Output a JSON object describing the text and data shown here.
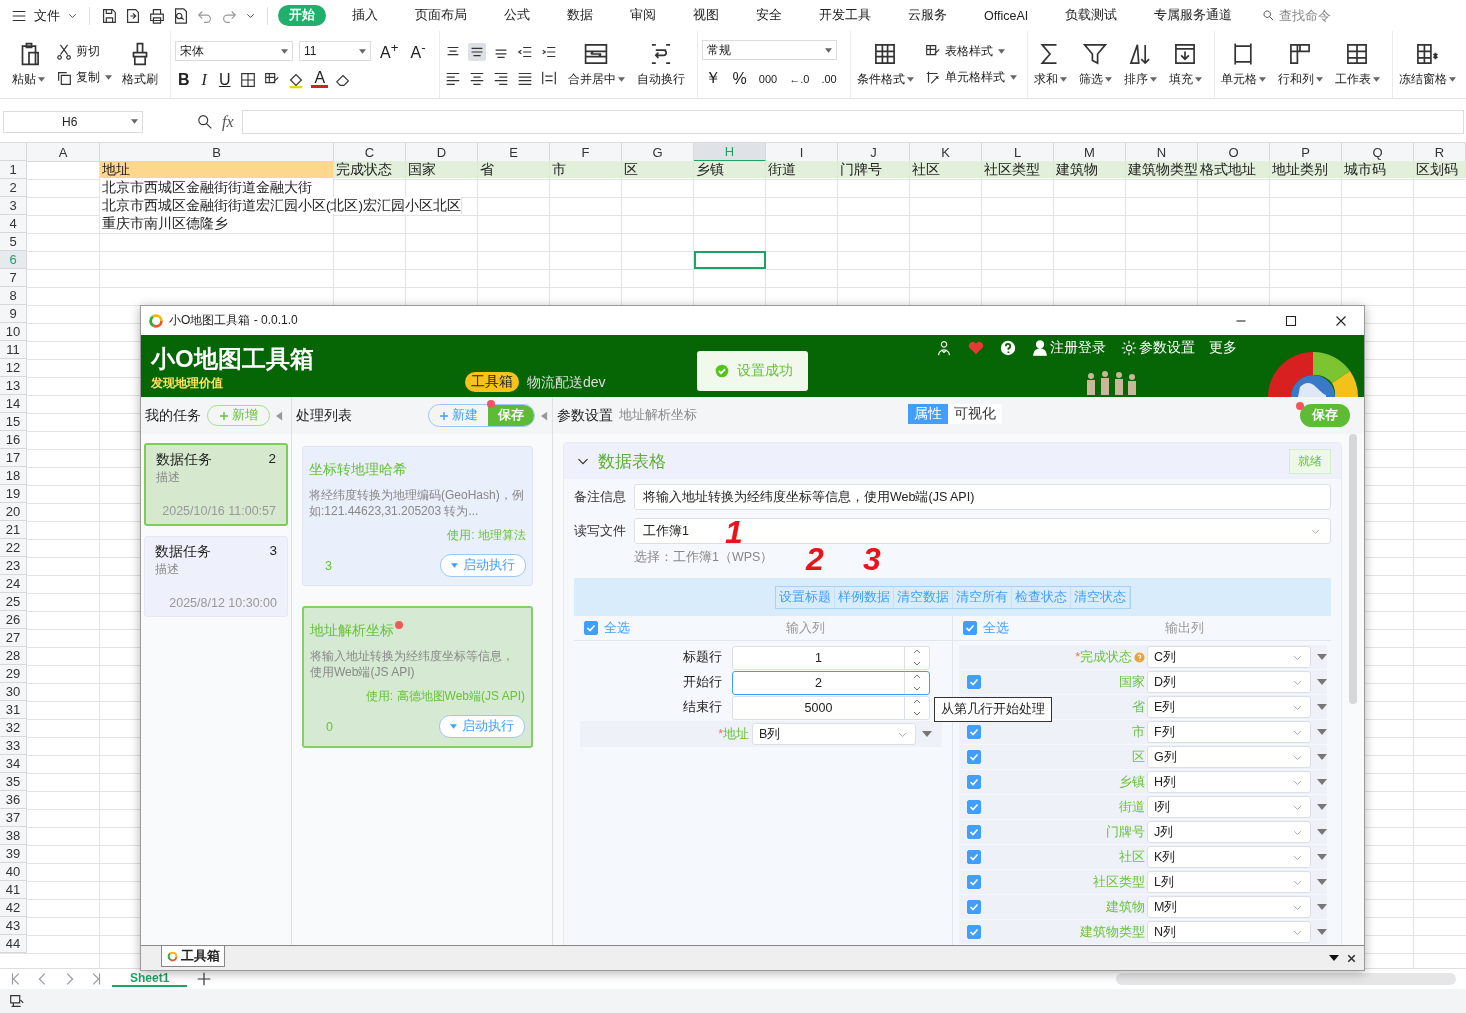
{
  "menu": {
    "file": "文件"
  },
  "ribbon_tabs": [
    {
      "label": "开始",
      "selected": true
    },
    {
      "label": "插入",
      "selected": false
    },
    {
      "label": "页面布局",
      "selected": false
    },
    {
      "label": "公式",
      "selected": false
    },
    {
      "label": "数据",
      "selected": false
    },
    {
      "label": "审阅",
      "selected": false
    },
    {
      "label": "视图",
      "selected": false
    },
    {
      "label": "安全",
      "selected": false
    },
    {
      "label": "开发工具",
      "selected": false
    },
    {
      "label": "云服务",
      "selected": false
    },
    {
      "label": "OfficeAI",
      "selected": false
    },
    {
      "label": "负载测试",
      "selected": false
    },
    {
      "label": "专属服务通道",
      "selected": false
    }
  ],
  "search": {
    "placeholder": "查找命令"
  },
  "ribbon": {
    "clipboard": [
      "粘贴",
      "剪切",
      "复制",
      "格式刷"
    ],
    "font_name": "宋体",
    "font_size": "11",
    "grow": "A$^{+}$",
    "shrink": "A$^{-}$",
    "bold": "B",
    "italic": "I",
    "underline": "U",
    "font_color": "A",
    "align": [
      "合并居中",
      "自动换行"
    ],
    "number_format": "常规",
    "currency": "￥",
    "percent": "%",
    "thousands": "000",
    "inc_decimal": "←.0",
    "dec_decimal": ".00",
    "styles": [
      "条件格式",
      "表格样式",
      "单元格样式"
    ],
    "editing": [
      "求和",
      "筛选",
      "排序",
      "填充"
    ],
    "cells": [
      "单元格",
      "行和列",
      "工作表"
    ],
    "freeze": "冻结窗格"
  },
  "formula_bar": {
    "name_box": "H6",
    "fx": "fx"
  },
  "sheet": {
    "columns": [
      {
        "label": "A",
        "selected": false
      },
      {
        "label": "B",
        "selected": false
      },
      {
        "label": "C",
        "selected": false
      },
      {
        "label": "D",
        "selected": false
      },
      {
        "label": "E",
        "selected": false
      },
      {
        "label": "F",
        "selected": false
      },
      {
        "label": "G",
        "selected": false
      },
      {
        "label": "H",
        "selected": true
      },
      {
        "label": "I",
        "selected": false
      },
      {
        "label": "J",
        "selected": false
      },
      {
        "label": "K",
        "selected": false
      },
      {
        "label": "L",
        "selected": false
      },
      {
        "label": "M",
        "selected": false
      },
      {
        "label": "N",
        "selected": false
      },
      {
        "label": "O",
        "selected": false
      },
      {
        "label": "P",
        "selected": false
      },
      {
        "label": "Q",
        "selected": false
      },
      {
        "label": "R",
        "selected": false
      }
    ],
    "rows": [
      {
        "number": "1",
        "selected": false,
        "cells": [
          {
            "text": "地址",
            "color": "#fdd78d"
          },
          {
            "text": "完成状态",
            "color": "#e2efda"
          },
          {
            "text": "国家",
            "color": "#e2efda"
          },
          {
            "text": "省",
            "color": "#e2efda"
          },
          {
            "text": "市",
            "color": "#e2efda"
          },
          {
            "text": "区",
            "color": "#e2efda"
          },
          {
            "text": "乡镇",
            "color": "#e2efda"
          },
          {
            "text": "街道",
            "color": "#e2efda"
          },
          {
            "text": "门牌号",
            "color": "#e2efda"
          },
          {
            "text": "社区",
            "color": "#e2efda"
          },
          {
            "text": "社区类型",
            "color": "#e2efda"
          },
          {
            "text": "建筑物",
            "color": "#e2efda"
          },
          {
            "text": "建筑物类型",
            "color": "#e2efda"
          },
          {
            "text": "格式地址",
            "color": "#e2efda"
          },
          {
            "text": "地址类别",
            "color": "#e2efda"
          },
          {
            "text": "城市码",
            "color": "#e2efda"
          },
          {
            "text": "区划码",
            "color": "#e2efda"
          }
        ]
      },
      {
        "number": "2",
        "selected": false,
        "cells": [
          {
            "text": "北京市西城区金融街街道金融大街"
          }
        ]
      },
      {
        "number": "3",
        "selected": false,
        "cells": [
          {
            "text": "北京市西城区金融街街道宏汇园小区(北区)宏汇园小区北区"
          }
        ]
      },
      {
        "number": "4",
        "selected": false,
        "cells": [
          {
            "text": "重庆市南川区德隆乡"
          }
        ]
      },
      {
        "number": "5",
        "selected": false
      },
      {
        "number": "6",
        "selected": true
      },
      {
        "number": "7",
        "selected": false
      },
      {
        "number": "8",
        "selected": false
      },
      {
        "number": "9",
        "selected": false
      },
      {
        "number": "10",
        "selected": false
      },
      {
        "number": "11",
        "selected": false
      },
      {
        "number": "12",
        "selected": false
      },
      {
        "number": "13",
        "selected": false
      },
      {
        "number": "14",
        "selected": false
      },
      {
        "number": "15",
        "selected": false
      },
      {
        "number": "16",
        "selected": false
      },
      {
        "number": "17",
        "selected": false
      },
      {
        "number": "18",
        "selected": false
      },
      {
        "number": "19",
        "selected": false
      },
      {
        "number": "20",
        "selected": false
      },
      {
        "number": "21",
        "selected": false
      },
      {
        "number": "22",
        "selected": false
      },
      {
        "number": "23",
        "selected": false
      },
      {
        "number": "24",
        "selected": false
      },
      {
        "number": "25",
        "selected": false
      },
      {
        "number": "26",
        "selected": false
      },
      {
        "number": "27",
        "selected": false
      },
      {
        "number": "28",
        "selected": false
      },
      {
        "number": "29",
        "selected": false
      },
      {
        "number": "30",
        "selected": false
      },
      {
        "number": "31",
        "selected": false
      },
      {
        "number": "32",
        "selected": false
      },
      {
        "number": "33",
        "selected": false
      },
      {
        "number": "34",
        "selected": false
      },
      {
        "number": "35",
        "selected": false
      },
      {
        "number": "36",
        "selected": false
      },
      {
        "number": "37",
        "selected": false
      },
      {
        "number": "38",
        "selected": false
      },
      {
        "number": "39",
        "selected": false
      },
      {
        "number": "40",
        "selected": false
      },
      {
        "number": "41",
        "selected": false
      },
      {
        "number": "42",
        "selected": false
      },
      {
        "number": "43",
        "selected": false
      },
      {
        "number": "44",
        "selected": false
      }
    ]
  },
  "sheet_tabs": [
    {
      "label": "Sheet1",
      "selected": true
    }
  ],
  "dialog": {
    "title": "小O地图工具箱 - 0.0.1.0",
    "header": {
      "app_name": "小O地图工具箱",
      "slogan": "发现地理价值",
      "badge": "工具箱",
      "project": "物流配送dev",
      "toast": "设置成功",
      "links": [
        "注册登录",
        "参数设置",
        "更多"
      ]
    },
    "tasks_panel": {
      "title": "我的任务",
      "add_button": "新增",
      "tasks": [
        {
          "name": "数据任务",
          "count": "2",
          "description": "描述",
          "time": "2025/10/16 11:00:57",
          "selected": true
        },
        {
          "name": "数据任务",
          "count": "3",
          "description": "描述",
          "time": "2025/8/12 10:30:00",
          "selected": false
        }
      ]
    },
    "process_panel": {
      "title": "处理列表",
      "new_button": "新建",
      "save_button": "保存",
      "unsaved": true,
      "items": [
        {
          "title": "坐标转地理哈希",
          "description": "将经纬度转换为地理编码(GeoHash)，例如:121.44623,31.205203 转为...",
          "usage": "使用: 地理算法",
          "count": "3",
          "run_button": "启动执行",
          "selected": false,
          "flagged": false
        },
        {
          "title": "地址解析坐标",
          "description": "将输入地址转换为经纬度坐标等信息，使用Web端(JS API)",
          "usage": "使用: 高德地图Web端(JS API)",
          "count": "0",
          "run_button": "启动执行",
          "selected": true,
          "flagged": true
        }
      ]
    },
    "settings_panel": {
      "title": "参数设置",
      "subtitle": "地址解析坐标",
      "view_tabs": [
        {
          "label": "属性",
          "selected": true
        },
        {
          "label": "可视化",
          "selected": false
        }
      ],
      "save_button": "保存",
      "unsaved": true,
      "section": {
        "title": "数据表格",
        "expanded": true,
        "status": "就绪",
        "note_label": "备注信息",
        "note_value": "将输入地址转换为经纬度坐标等信息，使用Web端(JS API)",
        "file_label": "读写文件",
        "file_value": "工作簿1",
        "file_hint": "选择：工作簿1（WPS）",
        "required_mark": "*",
        "annotations": [
          "1",
          "2",
          "3"
        ],
        "actions": [
          "设置标题",
          "样例数据",
          "清空数据",
          "清空所有",
          "检查状态",
          "清空状态"
        ],
        "input": {
          "select_all": "全选",
          "checked": true,
          "title": "输入列",
          "fields": [
            {
              "kind": "number",
              "label": "标题行",
              "value": "1",
              "focused": false
            },
            {
              "kind": "number",
              "label": "开始行",
              "value": "2",
              "focused": true
            },
            {
              "kind": "number",
              "label": "结束行",
              "value": "5000",
              "focused": false
            },
            {
              "kind": "column",
              "label": "地址",
              "value": "B列",
              "required": true
            }
          ]
        },
        "tooltip": "从第几行开始处理",
        "output": {
          "select_all": "全选",
          "checked": true,
          "title": "输出列",
          "fields": [
            {
              "kind": "required",
              "label": "完成状态",
              "value": "C列",
              "help": true
            },
            {
              "kind": "option",
              "label": "国家",
              "value": "D列",
              "checked": true
            },
            {
              "kind": "option",
              "label": "省",
              "value": "E列"
            },
            {
              "kind": "option",
              "label": "市",
              "value": "F列",
              "checked": true
            },
            {
              "kind": "option",
              "label": "区",
              "value": "G列",
              "checked": true
            },
            {
              "kind": "option",
              "label": "乡镇",
              "value": "H列",
              "checked": true
            },
            {
              "kind": "option",
              "label": "街道",
              "value": "I列",
              "checked": true
            },
            {
              "kind": "option",
              "label": "门牌号",
              "value": "J列",
              "checked": true
            },
            {
              "kind": "option",
              "label": "社区",
              "value": "K列",
              "checked": true
            },
            {
              "kind": "option",
              "label": "社区类型",
              "value": "L列",
              "checked": true
            },
            {
              "kind": "option",
              "label": "建筑物",
              "value": "M列",
              "checked": true
            },
            {
              "kind": "option",
              "label": "建筑物类型",
              "value": "N列",
              "checked": true
            }
          ]
        }
      }
    },
    "bottom_tab": {
      "label": "工具箱"
    }
  }
}
